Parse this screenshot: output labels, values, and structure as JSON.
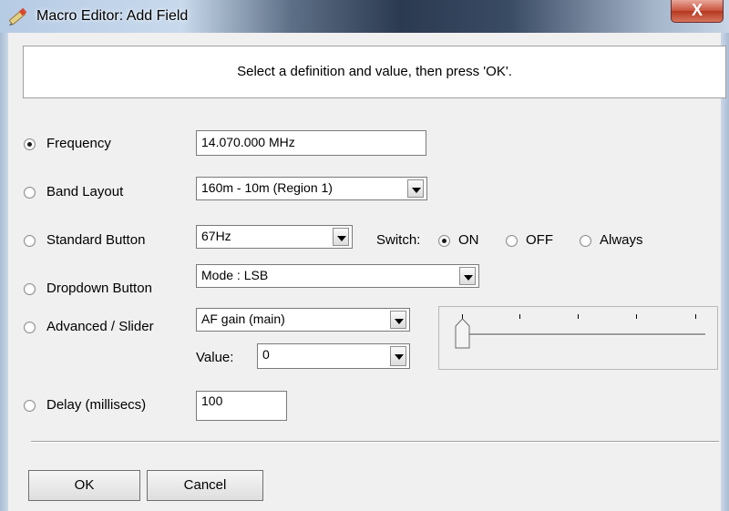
{
  "window": {
    "title": "Macro Editor: Add Field",
    "close_glyph": "X"
  },
  "banner": {
    "text": "Select a definition and value, then press 'OK'."
  },
  "rows": {
    "frequency": {
      "label": "Frequency",
      "value": "14.070.000 MHz",
      "selected": true
    },
    "band_layout": {
      "label": "Band Layout",
      "value": "160m - 10m (Region 1)",
      "selected": false
    },
    "standard_button": {
      "label": "Standard Button",
      "value": "67Hz",
      "selected": false,
      "switch_label": "Switch:",
      "switch_options": [
        "ON",
        "OFF",
        "Always"
      ],
      "switch_selected": "ON"
    },
    "dropdown_button": {
      "label": "Dropdown Button",
      "value": "Mode : LSB",
      "selected": false
    },
    "advanced_slider": {
      "label": "Advanced / Slider",
      "value": "AF gain (main)",
      "selected": false,
      "value_label": "Value:",
      "value_value": "0",
      "slider_level": 0
    },
    "delay": {
      "label": "Delay (millisecs)",
      "value": "100",
      "selected": false
    }
  },
  "buttons": {
    "ok": "OK",
    "cancel": "Cancel"
  },
  "colors": {
    "close_button": "#c9503b",
    "background": "#f0f0f0"
  },
  "icons": {
    "app": "pencil-icon",
    "close": "close-icon",
    "dropdown": "dropdown-arrow-icon"
  }
}
